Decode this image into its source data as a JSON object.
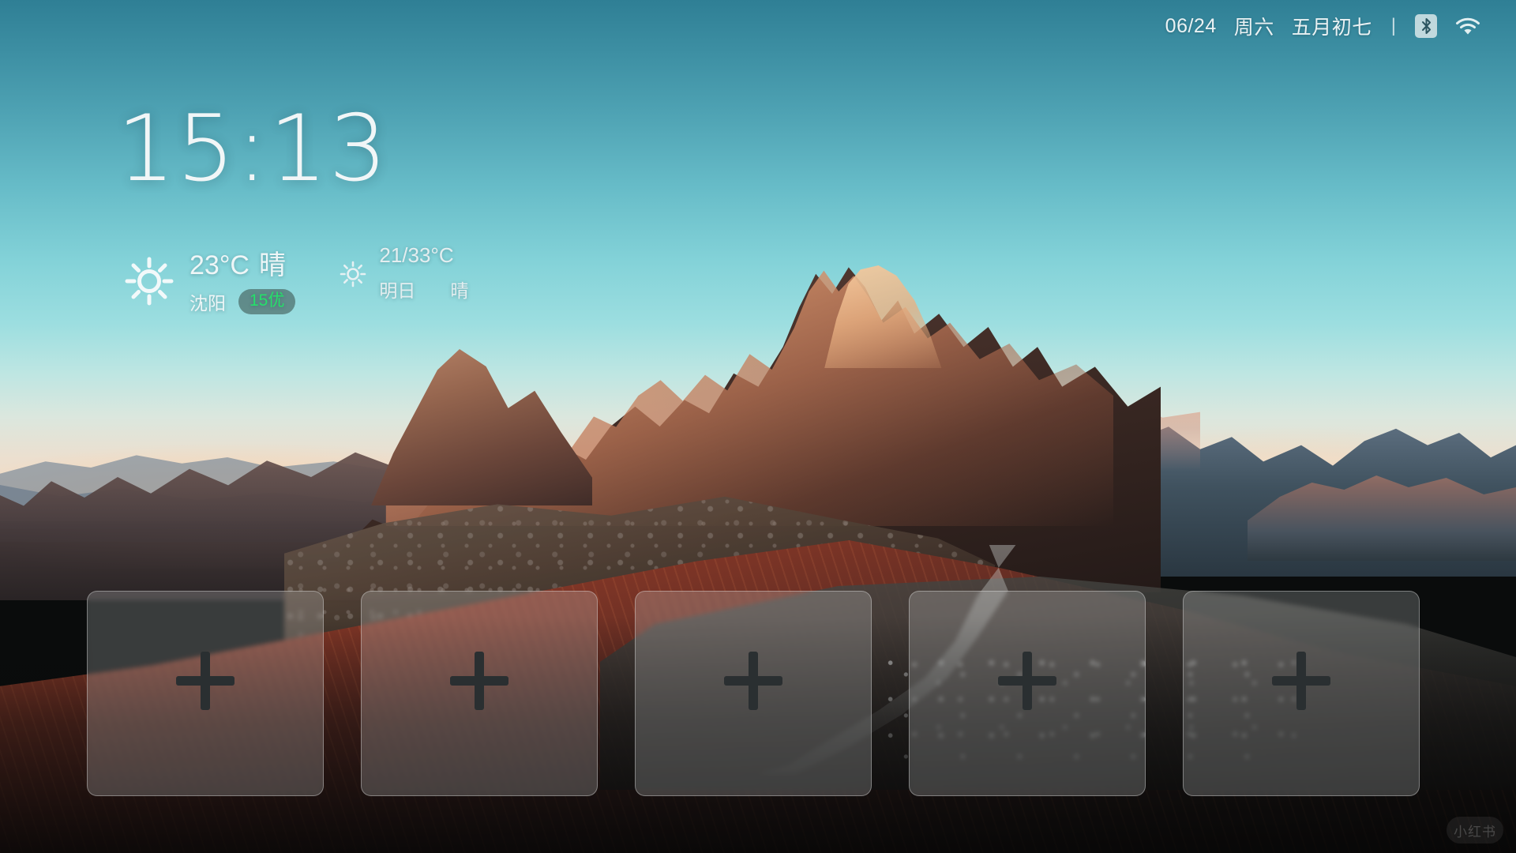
{
  "statusbar": {
    "date": "06/24",
    "weekday": "周六",
    "lunar": "五月初七",
    "separator": "|",
    "bluetooth_icon": "bluetooth-icon",
    "wifi_icon": "wifi-icon"
  },
  "clock": {
    "time": "15:13"
  },
  "weather": {
    "today_icon": "sun-icon",
    "temperature": "23°C",
    "condition": "晴",
    "city": "沈阳",
    "aqi": "15优",
    "aqi_color": "#25e06a",
    "tomorrow_icon": "sun-icon",
    "tomorrow_range": "21/33°C",
    "tomorrow_label": "明日",
    "tomorrow_condition": "晴"
  },
  "shortcuts": {
    "add_icon": "plus-icon",
    "cards": [
      {
        "label": "",
        "icon": "plus-icon"
      },
      {
        "label": "",
        "icon": "plus-icon"
      },
      {
        "label": "",
        "icon": "plus-icon"
      },
      {
        "label": "",
        "icon": "plus-icon"
      },
      {
        "label": "",
        "icon": "plus-icon"
      }
    ]
  },
  "watermark": {
    "text": "小红书"
  }
}
